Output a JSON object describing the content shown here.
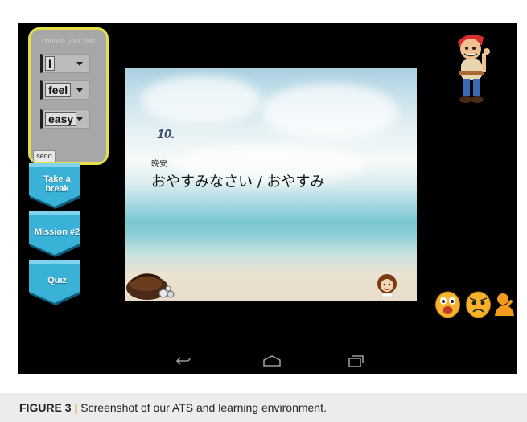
{
  "panel": {
    "title": "choose your feel",
    "dropdowns": [
      {
        "value": "I"
      },
      {
        "value": "feel"
      },
      {
        "value": "easy"
      }
    ],
    "send_label": "send"
  },
  "side_buttons": [
    {
      "label": "Take a break"
    },
    {
      "label": "Mission #2"
    },
    {
      "label": "Quiz"
    }
  ],
  "lesson": {
    "number": "10.",
    "chinese": "晚安",
    "japanese": "おやすみなさい / おやすみ"
  },
  "caption": {
    "label": "FIGURE 3",
    "separator": "|",
    "text": "Screenshot of our ATS and learning environment."
  },
  "colors": {
    "screen_bg": "#000000",
    "panel_border": "#e5e04a",
    "button_blue": "#3ab2d8",
    "caption_bg": "#ececec"
  },
  "icons": [
    "pirate-character-icon",
    "bag-icon",
    "mini-avatar-icon",
    "happy-face-icon",
    "frown-face-icon",
    "thinking-person-icon",
    "back-icon",
    "home-icon",
    "recents-icon"
  ]
}
